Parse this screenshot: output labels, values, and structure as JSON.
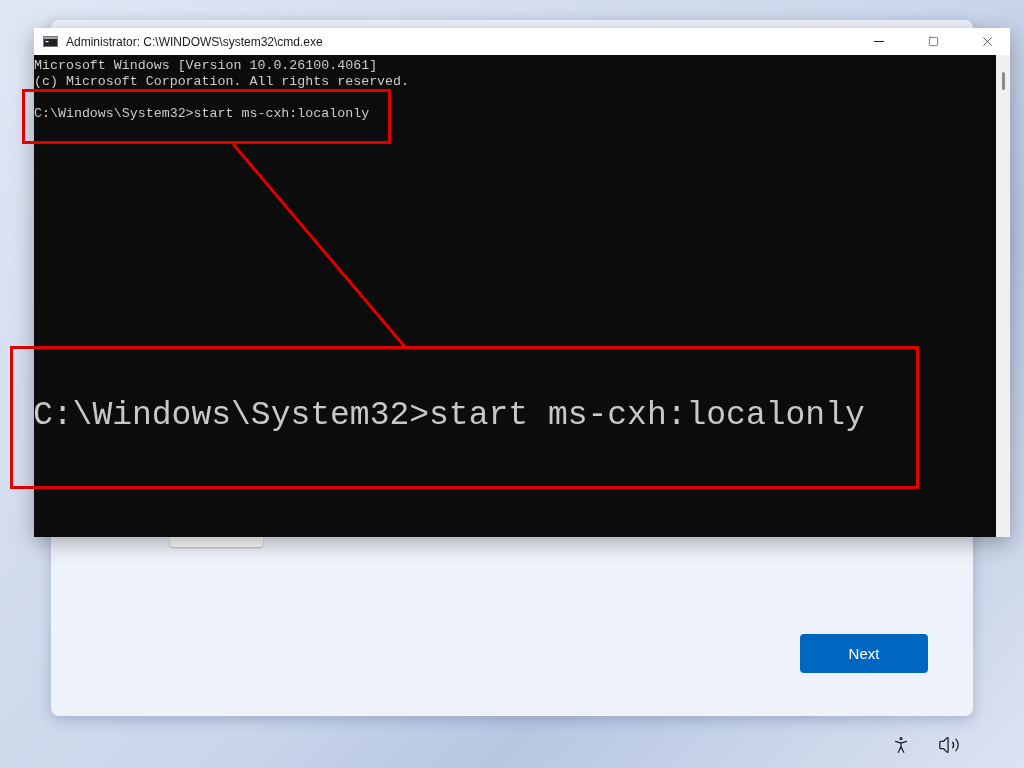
{
  "cmd_window": {
    "title": "Administrator: C:\\WINDOWS\\system32\\cmd.exe",
    "output_lines": [
      "Microsoft Windows [Version 10.0.26100.4061]",
      "(c) Microsoft Corporation. All rights reserved."
    ],
    "prompt": "C:\\Windows\\System32>start ms-cxh:localonly"
  },
  "callout": {
    "zoomed_text": "C:\\Windows\\System32>start ms-cxh:localonly"
  },
  "setup": {
    "next_button": "Next"
  }
}
